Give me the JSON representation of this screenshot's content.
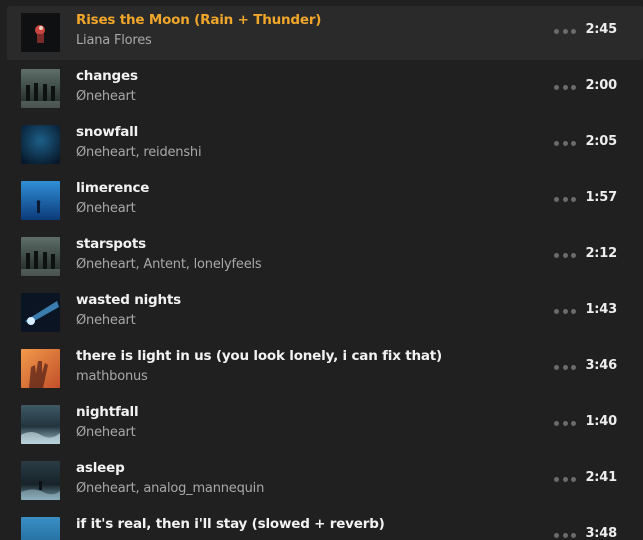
{
  "tracks": [
    {
      "title": "Rises the Moon (Rain + Thunder)",
      "artist": "Liana Flores",
      "duration": "2:45",
      "active": true,
      "art": "moon"
    },
    {
      "title": "changes",
      "artist": "Øneheart",
      "duration": "2:00",
      "active": false,
      "art": "figures"
    },
    {
      "title": "snowfall",
      "artist": "Øneheart, reidenshi",
      "duration": "2:05",
      "active": false,
      "art": "deepblue"
    },
    {
      "title": "limerence",
      "artist": "Øneheart",
      "duration": "1:57",
      "active": false,
      "art": "blue-figure"
    },
    {
      "title": "starspots",
      "artist": "Øneheart, Antent, lonelyfeels",
      "duration": "2:12",
      "active": false,
      "art": "figures"
    },
    {
      "title": "wasted nights",
      "artist": "Øneheart",
      "duration": "1:43",
      "active": false,
      "art": "light-beam"
    },
    {
      "title": "there is light in us (you look lonely, i can fix that)",
      "artist": "mathbonus",
      "duration": "3:46",
      "active": false,
      "art": "orange-hand"
    },
    {
      "title": "nightfall",
      "artist": "Øneheart",
      "duration": "1:40",
      "active": false,
      "art": "waves"
    },
    {
      "title": "asleep",
      "artist": "Øneheart, analog_mannequin",
      "duration": "2:41",
      "active": false,
      "art": "waves-dark"
    },
    {
      "title": "if it's real, then i'll stay (slowed + reverb)",
      "artist": "",
      "duration": "3:48",
      "active": false,
      "art": "sea-blue"
    }
  ],
  "colors": {
    "background": "#202020",
    "active_row": "#2a2a2a",
    "accent": "#f0a62a",
    "title": "#f2f2f2",
    "artist": "#a8a8a8",
    "more_dots": "#6b6b6b"
  },
  "icons": {
    "more": "more-options-icon"
  }
}
